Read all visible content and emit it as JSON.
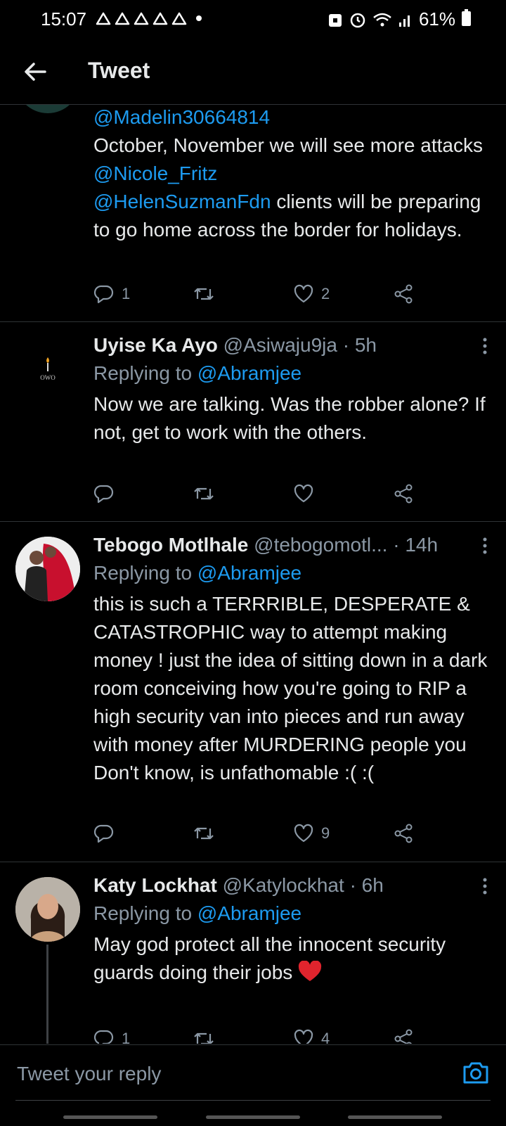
{
  "status_bar": {
    "time": "15:07",
    "battery": "61%"
  },
  "header": {
    "title": "Tweet"
  },
  "colors": {
    "link": "#1d9bf0",
    "heart": "#f91880",
    "muted": "#8b98a5"
  },
  "tweets": [
    {
      "mention_top": "@Madelin30664814",
      "text_parts": [
        "October, November we will see more attacks ",
        "@Nicole_Fritz",
        " ",
        "@HelenSuzmanFdn",
        " clients will be preparing to go home across the border for holidays."
      ],
      "replies": "1",
      "likes": "2"
    },
    {
      "name": "Uyise Ka Ayo",
      "handle": "@Asiwaju9ja",
      "time": "· 5h",
      "avatar_text": "OWO",
      "replying_prefix": "Replying to ",
      "replying_to": "@Abramjee",
      "text": "Now we are talking. Was the robber alone? If not, get to work with the others.",
      "replies": "",
      "likes": ""
    },
    {
      "name": "Tebogo Motlhale",
      "handle": "@tebogomotl...",
      "time": "· 14h",
      "replying_prefix": "Replying to ",
      "replying_to": "@Abramjee",
      "text": "this is such a TERRRIBLE, DESPERATE & CATASTROPHIC way to attempt making money ! just the idea of sitting down in a dark room conceiving how you're going to RIP a high security van into pieces and run away with money after MURDERING people you Don't know, is unfathomable :( :(",
      "replies": "",
      "likes": "9"
    },
    {
      "name": "Katy Lockhat",
      "handle": "@Katylockhat",
      "time": "· 6h",
      "replying_prefix": "Replying to ",
      "replying_to": "@Abramjee",
      "text": "May god protect all the innocent security guards doing their jobs",
      "emoji": "❤️",
      "replies": "1",
      "likes": "4"
    }
  ],
  "reply": {
    "placeholder": "Tweet your reply"
  },
  "icons": [
    "back-arrow-icon",
    "reply-icon",
    "retweet-icon",
    "like-icon",
    "share-icon",
    "more-icon",
    "camera-icon"
  ]
}
